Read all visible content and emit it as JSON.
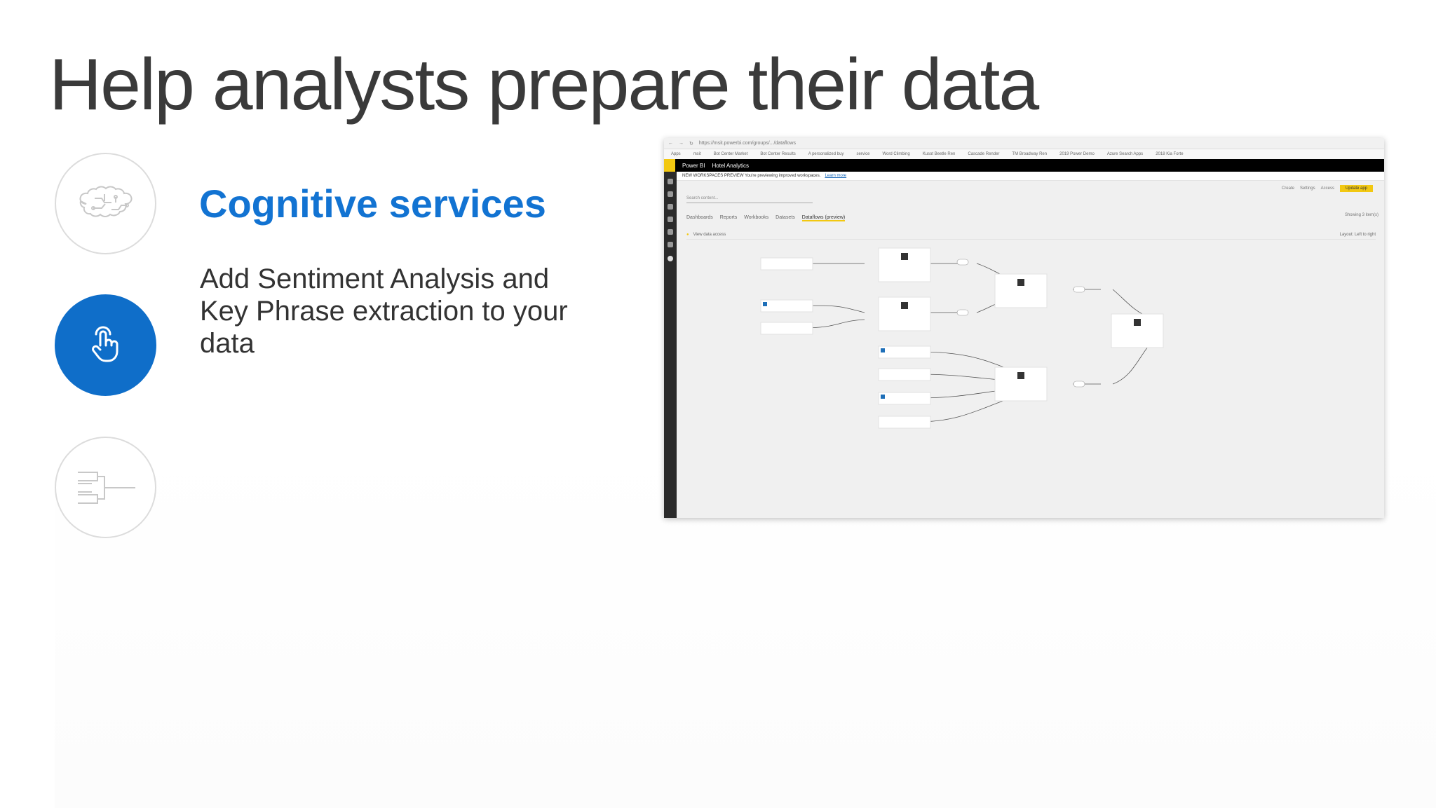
{
  "slide": {
    "title": "Help analysts prepare their data",
    "feature": {
      "title": "Cognitive services",
      "description": "Add Sentiment Analysis and Key Phrase extraction to your data"
    },
    "icons": [
      "brain-icon",
      "touch-hand-icon",
      "hierarchy-icon"
    ],
    "accent_color": "#1273d2",
    "active_circle_color": "#0f6ec9"
  },
  "screenshot": {
    "url": "https://msit.powerbi.com/groups/.../dataflows",
    "app_name": "Power BI",
    "workspace": "Hotel Analytics",
    "preview_banner": "NEW WORKSPACES PREVIEW   You're previewing improved workspaces.",
    "preview_link": "Learn more",
    "search_placeholder": "Search content...",
    "tabs": [
      "Dashboards",
      "Reports",
      "Workbooks",
      "Datasets",
      "Dataflows (preview)"
    ],
    "selected_tab": "Dataflows (preview)",
    "toolbar": [
      "Create",
      "Settings",
      "Access"
    ],
    "update_button": "Update app",
    "showing": "Showing 3 item(s)",
    "lineage_label": "View data access",
    "layout": "Layout: Left to right",
    "bookmarks": [
      "Apps",
      "msit",
      "Bot Center Market",
      "Bot Center Results",
      "A personalized buy",
      "service",
      "Word Climbing",
      "Kusot Beetle Ren",
      "Cascade Render",
      "TM Broadway Ren",
      "2019 Power Demo",
      "Azure Search Apps",
      "2018 Kia Forte"
    ],
    "colors": {
      "powerbi_yellow": "#f2c811",
      "header_black": "#000000"
    }
  }
}
